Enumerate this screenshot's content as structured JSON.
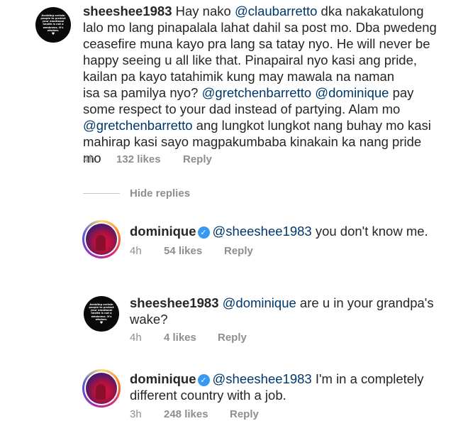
{
  "avatar_quote": {
    "text": "Avoiding certain people to protect your emotional health is not a weakness. It's wisdom.",
    "icon": "heart-icon"
  },
  "comments": [
    {
      "username": "sheeshee1983",
      "lines": [
        [
          {
            "t": "Hay nako "
          },
          {
            "m": "@claubarretto"
          },
          {
            "t": " dka nakakatulong"
          }
        ],
        [
          {
            "t": "lalo mo lang pinapalala lahat dahil sa post mo. Dba pwedeng"
          }
        ],
        [
          {
            "t": "ceasefire muna kayo pra lang sa tatay nyo. He will never be"
          }
        ],
        [
          {
            "t": "happy seeing u all like that. Pinapairal nyo kasi ang pride,"
          }
        ],
        [
          {
            "t": "kailan pa kayo tatahimik kung may mawala na naman"
          }
        ],
        [
          {
            "t": "isa sa pamilya nyo? "
          },
          {
            "m": "@gretchenbarretto"
          },
          {
            "t": " "
          },
          {
            "m": "@dominique"
          },
          {
            "t": " pay"
          }
        ],
        [
          {
            "t": "some respect to your dad instead of partying. Alam mo"
          }
        ],
        [
          {
            "m": "@gretchenbarretto"
          },
          {
            "t": " ang lungkot lungkot nang buhay mo kasi"
          }
        ],
        [
          {
            "t": "mahirap kasi sayo magpakumbaba kinakain ka nang pride"
          }
        ],
        [
          {
            "t": "mo"
          }
        ]
      ],
      "time": "4h",
      "likes": "132 likes",
      "reply": "Reply"
    }
  ],
  "hide_replies": "Hide replies",
  "replies": [
    {
      "username": "dominique",
      "verified": true,
      "lines": [
        [
          {
            "m": "@sheeshee1983"
          },
          {
            "t": " you don't know me."
          }
        ]
      ],
      "time": "4h",
      "likes": "54 likes",
      "reply": "Reply"
    },
    {
      "username": "sheeshee1983",
      "verified": false,
      "lines": [
        [
          {
            "m": "@dominique"
          },
          {
            "t": " are u in your grandpa's"
          }
        ],
        [
          {
            "t": "wake?"
          }
        ]
      ],
      "time": "4h",
      "likes": "4 likes",
      "reply": "Reply"
    },
    {
      "username": "dominique",
      "verified": true,
      "lines": [
        [
          {
            "m": "@sheeshee1983"
          },
          {
            "t": " I'm in a completely"
          }
        ],
        [
          {
            "t": "different country with a job."
          }
        ]
      ],
      "time": "3h",
      "likes": "248 likes",
      "reply": "Reply"
    }
  ]
}
